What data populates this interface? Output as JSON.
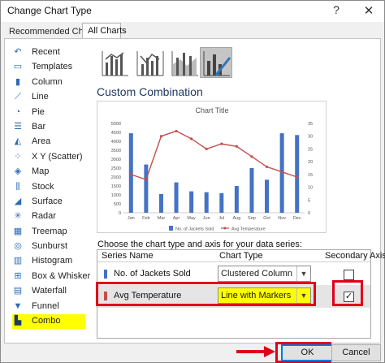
{
  "window": {
    "title": "Change Chart Type",
    "help": "?",
    "close": "✕"
  },
  "tabs": [
    {
      "label": "Recommended Charts",
      "active": false
    },
    {
      "label": "All Charts",
      "active": true
    }
  ],
  "nav": {
    "items": [
      {
        "label": "Recent",
        "icon": "recent-icon",
        "glyph": "↶"
      },
      {
        "label": "Templates",
        "icon": "templates-icon",
        "glyph": "▭"
      },
      {
        "label": "Column",
        "icon": "column-chart-icon",
        "glyph": "▮"
      },
      {
        "label": "Line",
        "icon": "line-chart-icon",
        "glyph": "⟋"
      },
      {
        "label": "Pie",
        "icon": "pie-chart-icon",
        "glyph": "◔"
      },
      {
        "label": "Bar",
        "icon": "bar-chart-icon",
        "glyph": "☰"
      },
      {
        "label": "Area",
        "icon": "area-chart-icon",
        "glyph": "◭"
      },
      {
        "label": "X Y (Scatter)",
        "icon": "scatter-chart-icon",
        "glyph": "⁘"
      },
      {
        "label": "Map",
        "icon": "map-chart-icon",
        "glyph": "◈"
      },
      {
        "label": "Stock",
        "icon": "stock-chart-icon",
        "glyph": "⫼"
      },
      {
        "label": "Surface",
        "icon": "surface-chart-icon",
        "glyph": "◢"
      },
      {
        "label": "Radar",
        "icon": "radar-chart-icon",
        "glyph": "✳"
      },
      {
        "label": "Treemap",
        "icon": "treemap-chart-icon",
        "glyph": "▦"
      },
      {
        "label": "Sunburst",
        "icon": "sunburst-chart-icon",
        "glyph": "◎"
      },
      {
        "label": "Histogram",
        "icon": "histogram-chart-icon",
        "glyph": "▥"
      },
      {
        "label": "Box & Whisker",
        "icon": "box-whisker-chart-icon",
        "glyph": "⊞"
      },
      {
        "label": "Waterfall",
        "icon": "waterfall-chart-icon",
        "glyph": "▤"
      },
      {
        "label": "Funnel",
        "icon": "funnel-chart-icon",
        "glyph": "▼"
      },
      {
        "label": "Combo",
        "icon": "combo-chart-icon",
        "glyph": "▙",
        "selected": true
      }
    ]
  },
  "section_title": "Custom Combination",
  "preview_chart": {
    "title": "Chart Title",
    "months": [
      "Jan",
      "Feb",
      "Mar",
      "Apr",
      "May",
      "Jun",
      "Jul",
      "Aug",
      "Sep",
      "Oct",
      "Nov",
      "Dec"
    ],
    "y_left_ticks": [
      "5000",
      "4500",
      "4000",
      "3500",
      "3000",
      "2500",
      "2000",
      "1500",
      "1000",
      "500",
      "0"
    ],
    "y_right_ticks": [
      "35",
      "30",
      "25",
      "20",
      "15",
      "10",
      "5",
      "0"
    ],
    "legend_jackets": "No. of Jackets Sold",
    "legend_temp": "Avg Temperature",
    "bar_color": "#4472c4",
    "line_color": "#c0504d"
  },
  "chart_data": {
    "type": "bar",
    "title": "Chart Title",
    "categories": [
      "Jan",
      "Feb",
      "Mar",
      "Apr",
      "May",
      "Jun",
      "Jul",
      "Aug",
      "Sep",
      "Oct",
      "Nov",
      "Dec"
    ],
    "series": [
      {
        "name": "No. of Jackets Sold",
        "type": "bar",
        "axis": "primary",
        "values": [
          4450,
          2700,
          1050,
          1700,
          1200,
          1150,
          1100,
          1500,
          2500,
          1850,
          4450,
          4350
        ]
      },
      {
        "name": "Avg Temperature",
        "type": "line",
        "axis": "secondary",
        "values": [
          15,
          13,
          30,
          32,
          29,
          25,
          27,
          26,
          22,
          18,
          16,
          14
        ]
      }
    ],
    "ylim_left": [
      0,
      5000
    ],
    "ylim_right": [
      0,
      35
    ],
    "legend": "bottom",
    "grid": false
  },
  "series_prompt": "Choose the chart type and axis for your data series:",
  "grid": {
    "headers": {
      "name": "Series Name",
      "type": "Chart Type",
      "axis": "Secondary Axis"
    },
    "rows": [
      {
        "name": "No. of Jackets Sold",
        "chart_type": "Clustered Column",
        "secondary": false,
        "color": "#4472c4"
      },
      {
        "name": "Avg Temperature",
        "chart_type": "Line with Markers",
        "secondary": true,
        "color": "#c0504d"
      }
    ]
  },
  "buttons": {
    "ok": "OK",
    "cancel": "Cancel"
  },
  "colors": {
    "highlight": "#ffff00",
    "annotation_red": "#e0001a",
    "accent": "#1f3864"
  }
}
